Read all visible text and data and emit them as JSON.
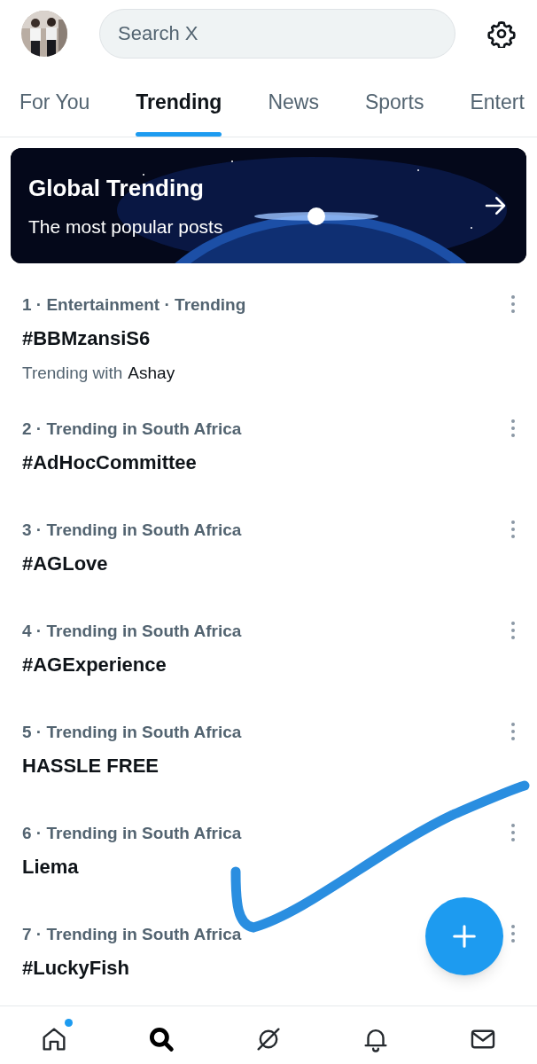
{
  "search": {
    "placeholder": "Search X"
  },
  "tabs": [
    {
      "label": "For You",
      "selected": false
    },
    {
      "label": "Trending",
      "selected": true
    },
    {
      "label": "News",
      "selected": false
    },
    {
      "label": "Sports",
      "selected": false
    },
    {
      "label": "Entert",
      "selected": false
    }
  ],
  "banner": {
    "title": "Global Trending",
    "subtitle": "The most popular posts"
  },
  "trends": [
    {
      "context": "1 · Entertainment · Trending",
      "title": "#BBMzansiS6",
      "trending_with": {
        "prefix": "Trending with",
        "name": "Ashay"
      }
    },
    {
      "context": "2 · Trending in South Africa",
      "title": "#AdHocCommittee"
    },
    {
      "context": "3 · Trending in South Africa",
      "title": "#AGLove"
    },
    {
      "context": "4 · Trending in South Africa",
      "title": "#AGExperience"
    },
    {
      "context": "5 · Trending in South Africa",
      "title": "HASSLE FREE"
    },
    {
      "context": "6 · Trending in South Africa",
      "title": "Liema"
    },
    {
      "context": "7 · Trending in South Africa",
      "title": "#LuckyFish"
    }
  ],
  "bottom_nav": [
    {
      "kind": "home",
      "selected": false,
      "badge": true
    },
    {
      "kind": "search",
      "selected": true,
      "badge": false
    },
    {
      "kind": "grok",
      "selected": false,
      "badge": false
    },
    {
      "kind": "notifications",
      "selected": false,
      "badge": false
    },
    {
      "kind": "messages",
      "selected": false,
      "badge": false
    }
  ]
}
